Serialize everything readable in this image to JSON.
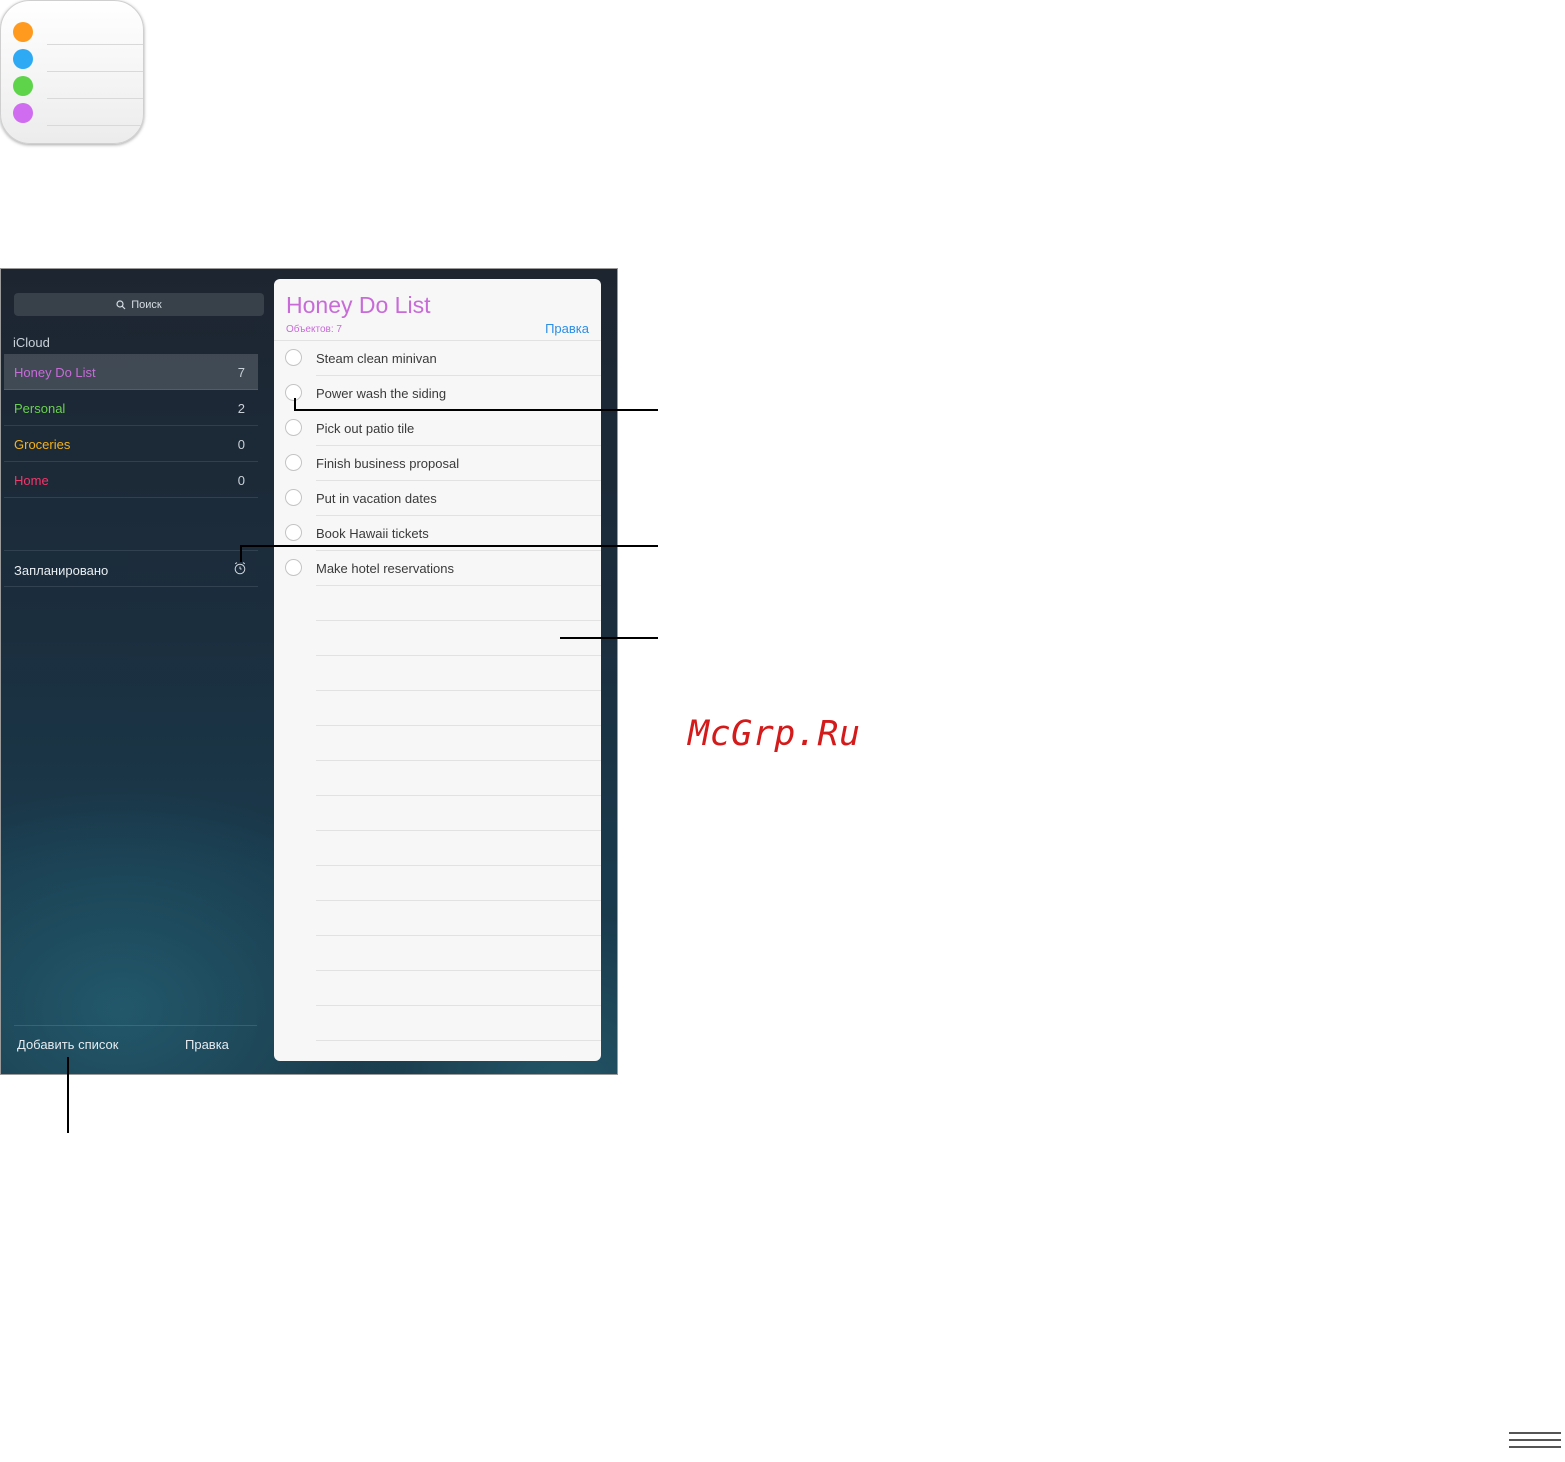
{
  "app_icon": {
    "name": "reminders-app-icon",
    "dot_colors": [
      "#ff9a1f",
      "#2eaaf5",
      "#5ed44a",
      "#cf6cf0"
    ]
  },
  "sidebar": {
    "search_placeholder": "Поиск",
    "section_title": "iCloud",
    "lists": [
      {
        "name": "Honey Do List",
        "count": "7",
        "color": "#c86bd9",
        "selected": true
      },
      {
        "name": "Personal",
        "count": "2",
        "color": "#68d14d",
        "selected": false
      },
      {
        "name": "Groceries",
        "count": "0",
        "color": "#f4b31b",
        "selected": false
      },
      {
        "name": "Home",
        "count": "0",
        "color": "#f2366a",
        "selected": false
      }
    ],
    "scheduled_label": "Запланировано",
    "scheduled_icon": "alarm-clock-icon",
    "footer": {
      "add_list_label": "Добавить список",
      "edit_label": "Правка"
    }
  },
  "detail": {
    "title": "Honey Do List",
    "subtitle": "Объектов: 7",
    "edit_label": "Правка",
    "accent_color": "#c86bd9",
    "edit_color": "#2c8ee6",
    "tasks": [
      "Steam clean minivan",
      "Power wash the siding",
      "Pick out patio tile",
      "Finish business proposal",
      "Put in vacation dates",
      "Book Hawaii tickets",
      "Make hotel reservations"
    ]
  },
  "watermark": "McGrp.Ru",
  "menu_icon": "hamburger-menu-icon"
}
